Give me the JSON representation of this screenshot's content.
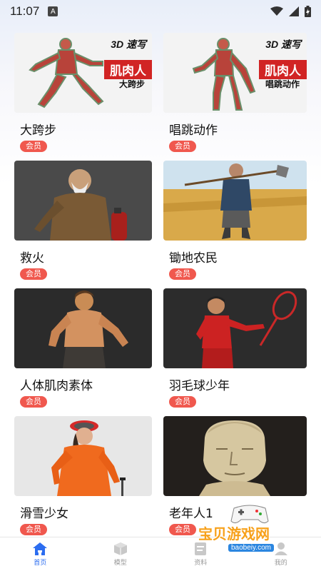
{
  "status_bar": {
    "time": "11:07",
    "badge": "A"
  },
  "items": [
    {
      "title": "大跨步",
      "badge": "会员",
      "overlay": {
        "brand": "3D 速写",
        "tag": "肌肉人",
        "sub": "大跨步"
      }
    },
    {
      "title": "唱跳动作",
      "badge": "会员",
      "overlay": {
        "brand": "3D 速写",
        "tag": "肌肉人",
        "sub": "唱跳动作"
      }
    },
    {
      "title": "救火",
      "badge": "会员"
    },
    {
      "title": "锄地农民",
      "badge": "会员"
    },
    {
      "title": "人体肌肉素体",
      "badge": "会员"
    },
    {
      "title": "羽毛球少年",
      "badge": "会员"
    },
    {
      "title": "滑雪少女",
      "badge": "会员"
    },
    {
      "title": "老年人1",
      "badge": "会员"
    }
  ],
  "nav": [
    {
      "label": "首页",
      "icon": "home-icon",
      "active": true
    },
    {
      "label": "模型",
      "icon": "cube-icon",
      "active": false
    },
    {
      "label": "资料",
      "icon": "document-icon",
      "active": false
    },
    {
      "label": "我的",
      "icon": "user-icon",
      "active": false
    }
  ],
  "watermark": {
    "text": "宝贝游戏网",
    "url": "baobeiy.com"
  },
  "colors": {
    "badge": "#f0584e",
    "active_nav": "#2c6df0",
    "inactive_nav": "#9a9a9a"
  }
}
